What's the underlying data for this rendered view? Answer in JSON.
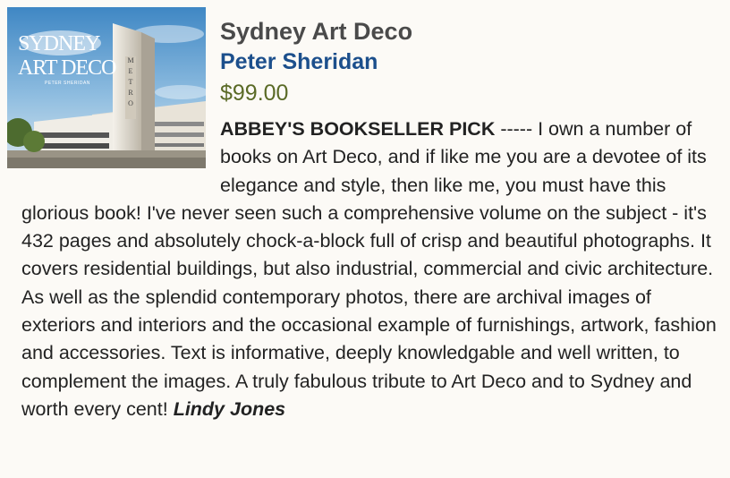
{
  "book": {
    "title": "Sydney Art Deco",
    "author": "Peter Sheridan",
    "price": "$99.00",
    "cover": {
      "title_line1": "SYDNEY",
      "title_line2": "ART DECO",
      "author": "PETER SHERIDAN",
      "building_sign": "METRO"
    }
  },
  "review": {
    "pick_label": "ABBEY'S BOOKSELLER PICK",
    "body": " ----- I own a number of books on Art Deco, and if like me you are a devotee of its elegance and style, then like me, you must have this glorious book! I've never seen such a comprehensive volume on the subject - it's 432 pages and absolutely chock-a-block full of crisp and beautiful photographs. It covers residential buildings, but also industrial, commercial and civic architecture. As well as the splendid contemporary photos, there are archival images of exteriors and interiors and the occasional example of furnishings, artwork, fashion and accessories. Text is informative, deeply knowledgable and well written, to complement the images. A truly fabulous tribute to Art Deco and to Sydney and worth every cent! ",
    "reviewer": "Lindy Jones"
  },
  "colors": {
    "background": "#fcfaf6",
    "title": "#4a4a4a",
    "author": "#1c4f8c",
    "price": "#5a6a26",
    "body": "#222222"
  }
}
